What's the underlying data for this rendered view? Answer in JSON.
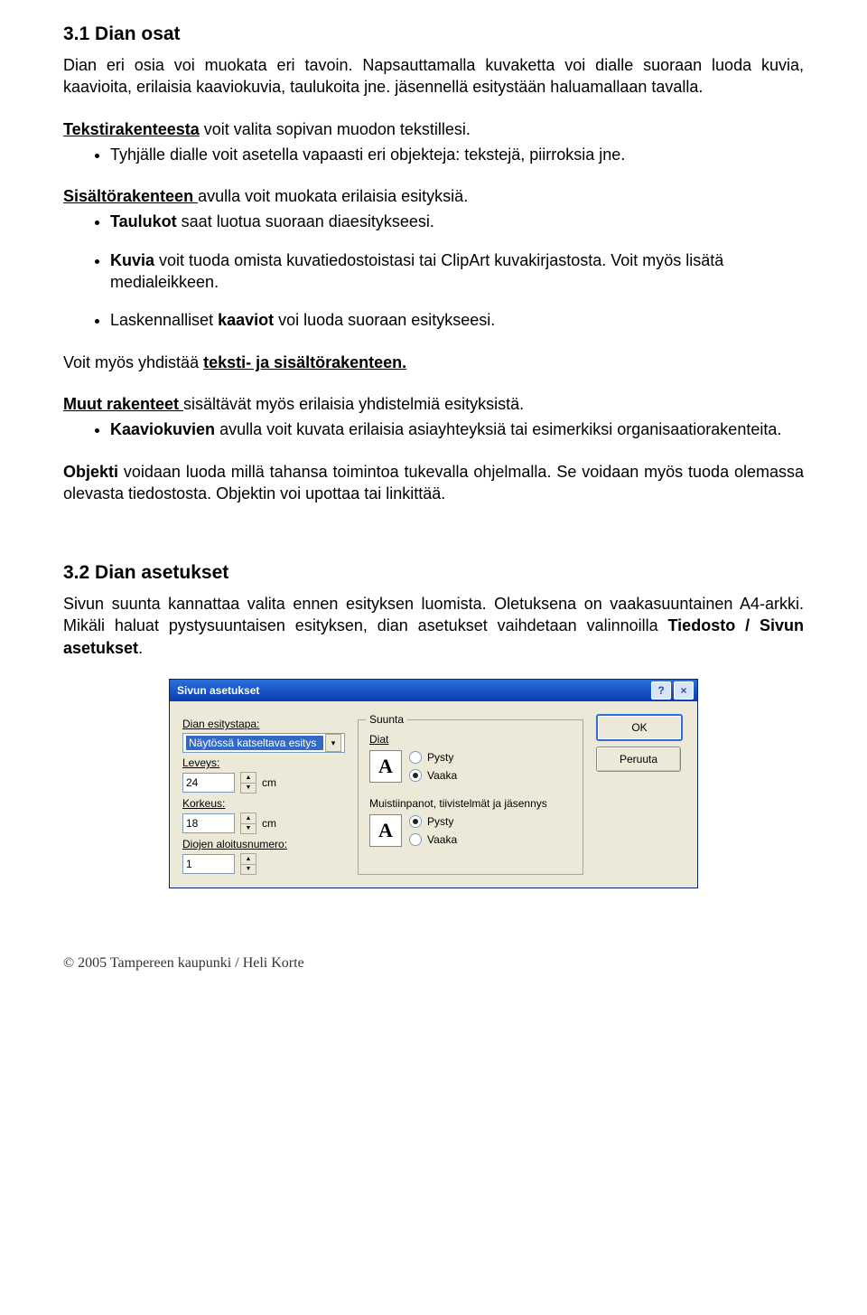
{
  "doc": {
    "heading1": "3.1 Dian osat",
    "p1": "Dian eri osia voi muokata eri tavoin. Napsauttamalla kuvaketta voi dialle suoraan luoda kuvia, kaavioita, erilaisia kaaviokuvia, taulukoita jne. jäsennellä esitystään haluamallaan tavalla.",
    "p2a": "Tekstirakenteesta",
    "p2b": " voit valita sopivan muodon tekstillesi.",
    "li_tyhjalle": "Tyhjälle dialle voit asetella vapaasti eri objekteja: tekstejä, piirroksia jne.",
    "p3a": "Sisältörakenteen ",
    "p3b": "avulla voit muokata erilaisia esityksiä.",
    "li_taulukot_b": "Taulukot",
    "li_taulukot_r": " saat luotua suoraan diaesitykseesi.",
    "li_kuvia_b": "Kuvia",
    "li_kuvia_r": " voit tuoda omista kuvatiedostoistasi tai ClipArt kuvakirjastosta. Voit myös lisätä medialeikkeen.",
    "li_kaaviot_a": "Laskennalliset ",
    "li_kaaviot_b": "kaaviot",
    "li_kaaviot_r": " voi luoda suoraan esitykseesi.",
    "p4a": "Voit myös yhdistää ",
    "p4b": "teksti- ja sisältörakenteen.",
    "p5a": "Muut rakenteet ",
    "p5b": "sisältävät myös erilaisia yhdistelmiä esityksistä.",
    "li_kaaviokuvien_b": "Kaaviokuvien",
    "li_kaaviokuvien_r": " avulla voit kuvata erilaisia asiayhteyksiä tai esimerkiksi organisaatiorakenteita.",
    "p6a": "Objekti",
    "p6b": " voidaan luoda millä tahansa toimintoa tukevalla ohjelmalla. Se voidaan myös tuoda olemassa olevasta tiedostosta. Objektin voi upottaa tai linkittää.",
    "heading2": "3.2 Dian asetukset",
    "p7a": "Sivun suunta kannattaa valita ennen esityksen luomista. Oletuksena on vaakasuuntainen A4-arkki. Mikäli haluat pystysuuntaisen esityksen, dian asetukset vaihdetaan valinnoilla ",
    "p7b": "Tiedosto / Sivun asetukset",
    "p7c": "."
  },
  "dialog": {
    "title": "Sivun asetukset",
    "help": "?",
    "close": "×",
    "esitystapa_lbl": "Dian esitystapa:",
    "esitystapa_val": "Näytössä katseltava esitys",
    "leveys_lbl": "Leveys:",
    "leveys_val": "24",
    "korkeus_lbl": "Korkeus:",
    "korkeus_val": "18",
    "aloitus_lbl": "Diojen aloitusnumero:",
    "aloitus_val": "1",
    "unit": "cm",
    "suunta_legend": "Suunta",
    "diat_lbl": "Diat",
    "pysty": "Pysty",
    "vaaka": "Vaaka",
    "muist_lbl": "Muistiinpanot, tiivistelmät ja jäsennys",
    "ok": "OK",
    "peruuta": "Peruuta",
    "icon_letter": "A"
  },
  "footer": "© 2005 Tampereen kaupunki / Heli Korte"
}
